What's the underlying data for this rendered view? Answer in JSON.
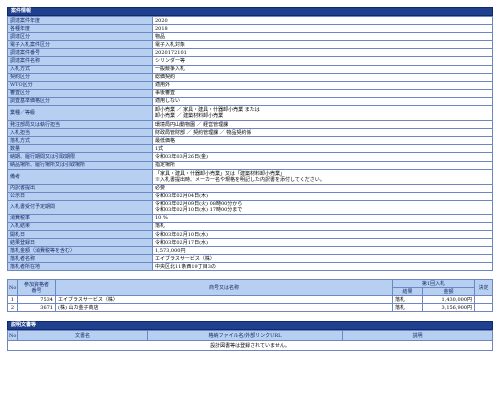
{
  "section1_title": "案件情報",
  "info_rows": [
    {
      "label": "調達案件年度",
      "value": "2020"
    },
    {
      "label": "各種年度",
      "value": "2018"
    },
    {
      "label": "調達区分",
      "value": "物品"
    },
    {
      "label": "電子入札案件区分",
      "value": "電子入札対象"
    },
    {
      "label": "調達案件番号",
      "value": "2020172101"
    },
    {
      "label": "調達案件名称",
      "value": "シリンダー等"
    },
    {
      "label": "入札方式",
      "value": "一般競争入札"
    },
    {
      "label": "契約区分",
      "value": "総価契約"
    },
    {
      "label": "WTO区分",
      "value": "適用外"
    },
    {
      "label": "審査区分",
      "value": "事後審査"
    },
    {
      "label": "調査基準価格区分",
      "value": "適用しない"
    },
    {
      "label": "業種／等級",
      "value": "卸小売業 ／ 家具・建具・什器卸小売業 または\n卸小売業 ／ 建築材料卸小売業",
      "tall": true
    },
    {
      "label": "発注部局又は執行担当",
      "value": "環境局円山動物園 ／ 経営管理課"
    },
    {
      "label": "入札担当",
      "value": "財政局管財部 ／ 契約管理課 ／ 物品契約係"
    },
    {
      "label": "落札方式",
      "value": "最低価格"
    },
    {
      "label": "数量",
      "value": "1式"
    },
    {
      "label": "納期、履行期間又は引取期限",
      "value": "令和03年03月26日(金)"
    },
    {
      "label": "納品場所、履行場所又は引取場所",
      "value": "指定場所"
    },
    {
      "label": "備考",
      "value": "「家具・建具・什器卸小売業」又は「建築材料卸小売業」\n※入札書提出時、メーカー名や規格を明記した内訳書を添付してください。",
      "tall": true
    },
    {
      "label": "内訳書提出",
      "value": "必要"
    },
    {
      "label": "公示日",
      "value": "令和03年02月04日(木)"
    },
    {
      "label": "入札書受付予定期間",
      "value": "令和03年02月09日(火) 08時00分から\n令和03年02月10日(水) 17時00分まで",
      "tall3": true
    },
    {
      "label": "消費税率",
      "value": "10 %"
    },
    {
      "label": "入札結果",
      "value": "落札"
    },
    {
      "label": "開札日",
      "value": "令和03年02月10日(水)"
    },
    {
      "label": "結果登録日",
      "value": "令和03年02月17日(水)"
    },
    {
      "label": "落札金額（消費税等を含む）",
      "value": "1,573,000円"
    },
    {
      "label": "落札者名称",
      "value": "エイブラスサービス（株）"
    },
    {
      "label": "落札者所在地",
      "value": "中央区北11条西19丁目3の"
    }
  ],
  "result_table": {
    "headers": {
      "no": "No",
      "reg": "参加資格者\n番号",
      "name": "商号又は名称",
      "round1": "第1回入札",
      "result": "結果",
      "amount": "金額",
      "decision": "決定"
    },
    "rows": [
      {
        "no": "1",
        "reg": "7534",
        "name": "エイブラスサービス（株）",
        "result": "落札",
        "amount": "1,430,000円",
        "decision": ""
      },
      {
        "no": "2",
        "reg": "3671",
        "name": "(株) 山カ金子商店",
        "result": "落札",
        "amount": "3,156,900円",
        "decision": ""
      }
    ]
  },
  "section2_title": "説明文書等",
  "docs_table": {
    "headers": {
      "no": "No",
      "doc": "文書名",
      "file": "格納ファイル名/外部リンクURL",
      "desc": "説明"
    },
    "empty_message": "設計図書等は登録されていません。"
  }
}
